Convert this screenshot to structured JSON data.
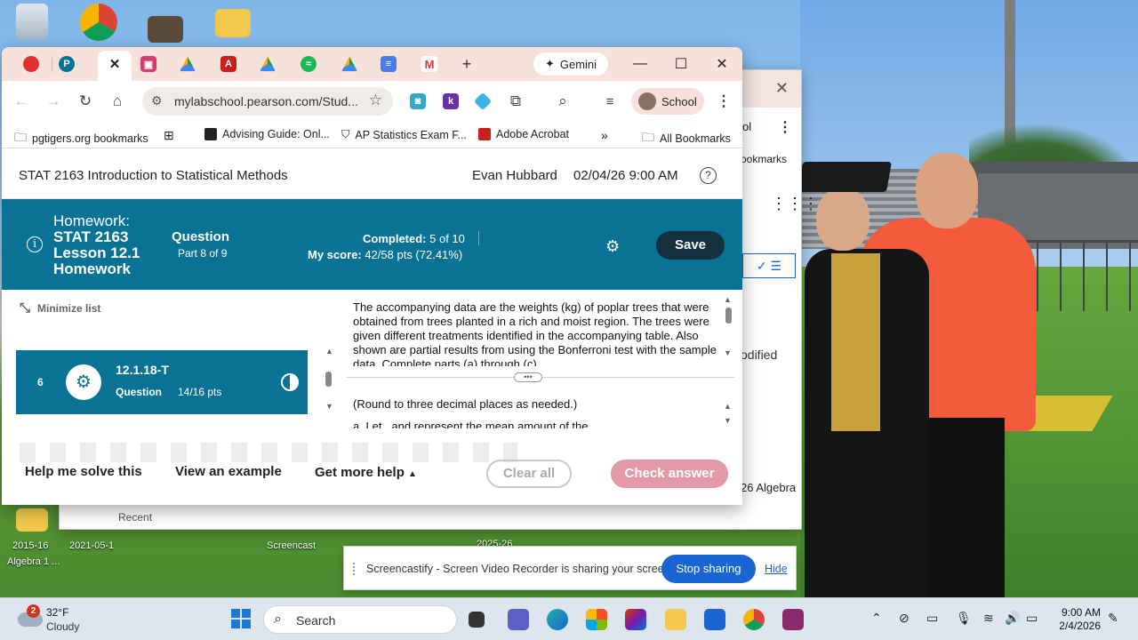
{
  "browser": {
    "gemini_label": "Gemini",
    "url": "mylabschool.pearson.com/Stud...",
    "profile_label": "School",
    "bookmarks": [
      "pgtigers.org bookmarks",
      "Advising Guide: Onl...",
      "AP Statistics Exam F...",
      "Adobe Acrobat",
      "All Bookmarks"
    ]
  },
  "header": {
    "course_title": "STAT 2163 Introduction to Statistical Methods",
    "student": "Evan Hubbard",
    "due": "02/04/26 9:00 AM"
  },
  "homework": {
    "label": "Homework:",
    "name": "STAT 2163 Lesson 12.1 Homework",
    "question_label": "Question",
    "part": "Part 8 of 9",
    "completed_label": "Completed:",
    "completed_value": "5 of 10",
    "score_label": "My score:",
    "score_value": "42/58 pts (72.41%)",
    "save_label": "Save"
  },
  "question_list": {
    "minimize_label": "Minimize list",
    "item": {
      "number": "6",
      "id": "12.1.18-T",
      "type": "Question",
      "points": "14/16 pts"
    }
  },
  "problem": {
    "text": "The accompanying data are the weights (kg) of poplar trees that were obtained from trees planted in a rich and moist region. The trees were given different treatments identified in the accompanying table. Also shown are partial results from using the Bonferroni test with the sample data. Complete parts (a) through (c).",
    "round_note": "(Round to three decimal places as needed.)",
    "partial_line": "a. Let    ,    and    represent the mean amount of the"
  },
  "actions": {
    "help_solve": "Help me solve this",
    "view_example": "View an example",
    "more_help": "Get more help",
    "clear_all": "Clear all",
    "check_answer": "Check answer"
  },
  "background_window": {
    "bookmarks_partial": "ookmarks",
    "ol_partial": "ol",
    "modified_partial": "odified",
    "algebra_partial": "26 Algebra",
    "recent_partial": "Recent"
  },
  "desktop": {
    "labels": [
      "2015-16",
      "2021-05-1",
      "Algebra 1 ...",
      "Screencast",
      "2025-26"
    ]
  },
  "sharebar": {
    "message": "Screencastify - Screen Video Recorder is sharing your screen.",
    "stop_label": "Stop sharing",
    "hide_label": "Hide"
  },
  "taskbar": {
    "weather_badge": "2",
    "temperature": "32°F",
    "condition": "Cloudy",
    "search_label": "Search",
    "time": "9:00 AM",
    "date": "2/4/2026"
  },
  "colors": {
    "accent_teal": "#0a7294",
    "save_dark": "#15303f",
    "check_pink": "#e39aa6",
    "share_blue": "#1a65d1",
    "tabstrip": "#f6e2db"
  }
}
